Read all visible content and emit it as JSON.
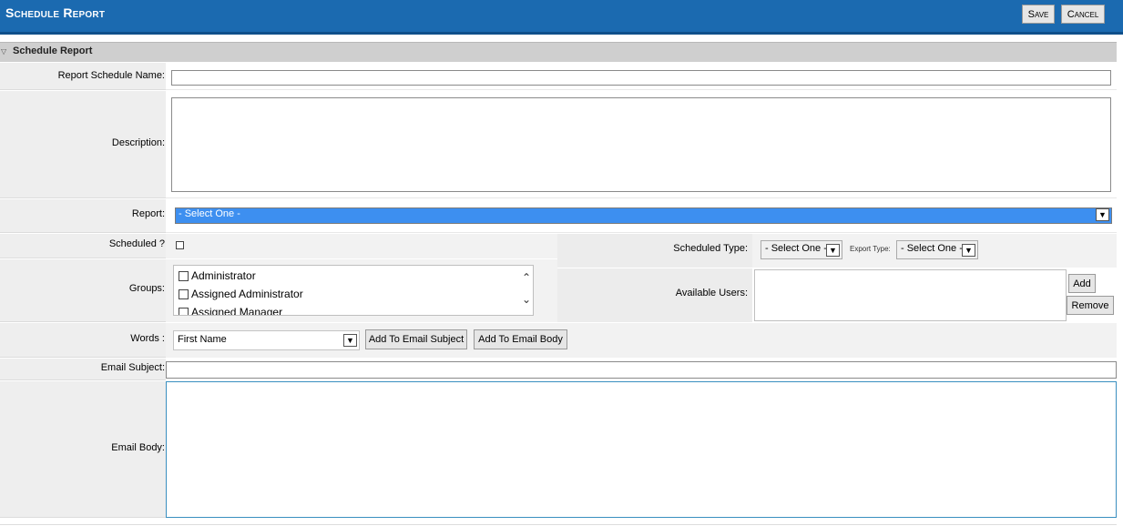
{
  "header": {
    "title": "Schedule Report",
    "save_label": "Save",
    "cancel_label": "Cancel"
  },
  "section": {
    "title": "Schedule Report",
    "icon": "triangle-down-icon"
  },
  "form": {
    "schedule_name_label": "Report Schedule Name:",
    "schedule_name_value": "",
    "description_label": "Description:",
    "description_value": "",
    "report_label": "Report:",
    "report_selected": "- Select One -",
    "scheduled_label": "Scheduled ?",
    "scheduled_checked": false,
    "scheduled_type_label": "Scheduled Type:",
    "scheduled_type_selected": "- Select One -",
    "export_type_label": "Export Type:",
    "export_type_selected": "- Select One -",
    "groups_label": "Groups:",
    "groups": [
      {
        "label": "Administrator",
        "checked": false
      },
      {
        "label": "Assigned Administrator",
        "checked": false
      },
      {
        "label": "Assigned Manager",
        "checked": false
      }
    ],
    "available_users_label": "Available Users:",
    "add_label": "Add",
    "remove_label": "Remove",
    "words_label": "Words :",
    "words_selected": "First Name",
    "add_to_subject_label": "Add To Email Subject",
    "add_to_body_label": "Add To Email Body",
    "email_subject_label": "Email Subject:",
    "email_subject_value": "",
    "email_body_label": "Email Body:",
    "email_body_value": ""
  },
  "colors": {
    "header_bg": "#1b6ab0",
    "section_bg": "#cfcfcf",
    "select_highlight": "#3d8ff0"
  }
}
